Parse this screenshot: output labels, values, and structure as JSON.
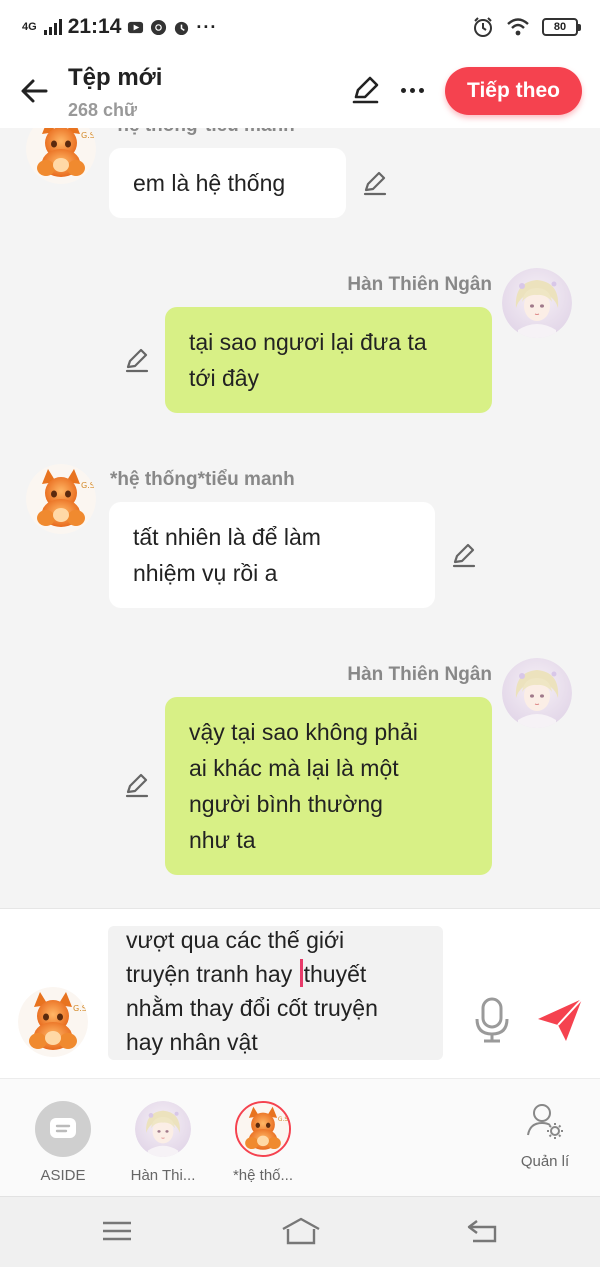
{
  "status_bar": {
    "network": "4G",
    "time": "21:14",
    "battery": "80"
  },
  "header": {
    "title": "Tệp mới",
    "word_count": "268 chữ",
    "next_label": "Tiếp theo"
  },
  "messages": [
    {
      "side": "left",
      "sender": "*hệ thống*tiểu manh",
      "lines": [
        "em là hệ thống"
      ]
    },
    {
      "side": "right",
      "sender": "Hàn Thiên Ngân",
      "lines": [
        "tại sao ngươi lại đưa ta",
        "tới đây"
      ]
    },
    {
      "side": "left",
      "sender": "*hệ thống*tiểu manh",
      "lines": [
        "tất nhiên là để làm",
        "nhiệm vụ rồi a"
      ]
    },
    {
      "side": "right",
      "sender": "Hàn Thiên Ngân",
      "lines": [
        "vậy tại sao không phải",
        "ai khác mà lại là một",
        "người bình thường",
        "như ta"
      ]
    }
  ],
  "composer": {
    "line1": "vượt qua các thế giới",
    "line2_before_caret": "truyện tranh hay ",
    "line2_after_caret": "thuyết",
    "line3": "nhằm thay đổi cốt truyện",
    "line4": "hay nhân vật"
  },
  "roles": [
    {
      "label": "ASIDE"
    },
    {
      "label": "Hàn Thi..."
    },
    {
      "label": "*hệ thố..."
    }
  ],
  "manage_label": "Quản lí",
  "colors": {
    "accent": "#f5424f",
    "bubble_green": "#d8f086",
    "bubble_white": "#ffffff",
    "background": "#f4f4f4"
  }
}
